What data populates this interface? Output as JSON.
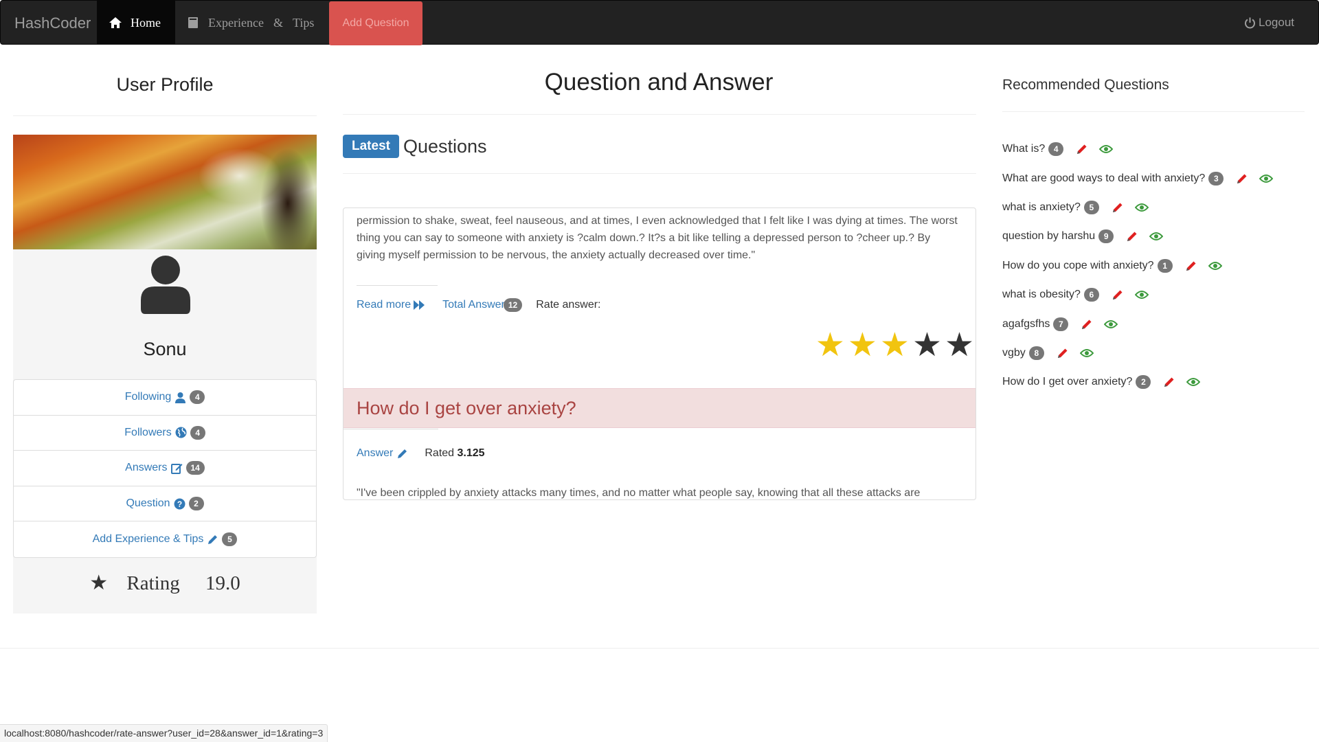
{
  "nav": {
    "brand": "HashCoder",
    "home": "Home",
    "experience_parts": [
      "Experience",
      "&",
      "Tips"
    ],
    "add_question": "Add Question",
    "logout": "Logout"
  },
  "profile": {
    "heading": "User Profile",
    "name": "Sonu",
    "stats": [
      {
        "label": "Following",
        "icon": "user-icon",
        "count": "4"
      },
      {
        "label": "Followers",
        "icon": "globe-icon",
        "count": "4"
      },
      {
        "label": "Answers",
        "icon": "edit-square-icon",
        "count": "14"
      },
      {
        "label": "Question",
        "icon": "question-circle-icon",
        "count": "2"
      },
      {
        "label": "Add Experience & Tips",
        "icon": "pencil-icon",
        "count": "5"
      }
    ],
    "rating_label": "Rating",
    "rating_value": "19.0"
  },
  "main": {
    "title": "Question and Answer",
    "latest_label": "Latest",
    "latest_text": "Questions",
    "answer_cut_line": "permission to shake, sweat, feel nauseous, and at times, I even acknowledged that I felt like I was dying at times. The worst",
    "answer_text": "permission to shake, sweat, feel nauseous, and at times, I even acknowledged that I felt like I was dying at times. The worst thing you can say to someone with anxiety is ?calm down.? It?s a bit like telling a depressed person to ?cheer up.? By giving myself permission to be nervous, the anxiety actually decreased over time.\"",
    "read_more": "Read more",
    "total_answer": "Total Answer",
    "total_answer_count": "12",
    "rate_answer": "Rate answer:",
    "rating_stars": 3,
    "rating_stars_max": 5,
    "star_colors": {
      "filled": "#f1c40f",
      "empty": "#333333"
    },
    "question_heading": "How do I get over anxiety?",
    "answer_link": "Answer",
    "rated_label": "Rated",
    "rated_value": "3.125",
    "answer_preview": "\"I've been crippled by anxiety attacks many times, and no matter what people say, knowing that all these attacks are"
  },
  "recommended": {
    "heading": "Recommended Questions",
    "items": [
      {
        "text": "What is?",
        "count": "4"
      },
      {
        "text": "What are good ways to deal with anxiety?",
        "count": "3"
      },
      {
        "text": "what is anxiety?",
        "count": "5"
      },
      {
        "text": "question by harshu",
        "count": "9"
      },
      {
        "text": "How do you cope with anxiety?",
        "count": "1"
      },
      {
        "text": "what is obesity?",
        "count": "6"
      },
      {
        "text": "agafgsfhs",
        "count": "7"
      },
      {
        "text": "vgby",
        "count": "8"
      },
      {
        "text": "How do I get over anxiety?",
        "count": "2"
      }
    ]
  },
  "status_url": "localhost:8080/hashcoder/rate-answer?user_id=28&answer_id=1&rating=3"
}
